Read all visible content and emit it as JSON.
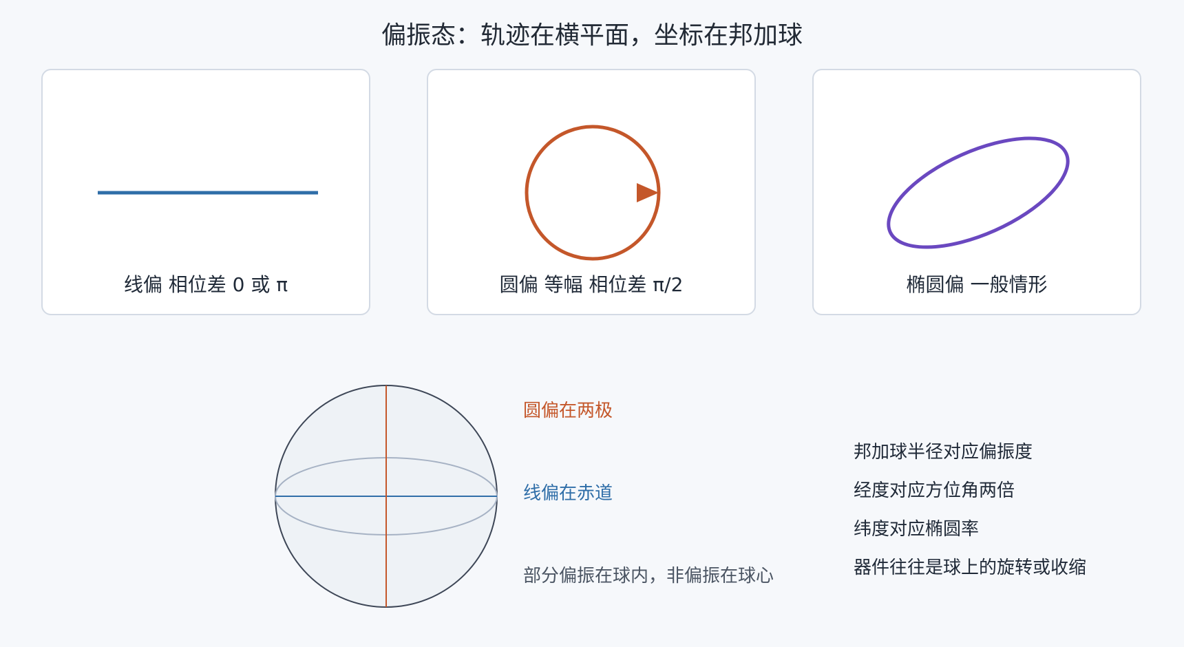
{
  "title": "偏振态：轨迹在横平面，坐标在邦加球",
  "cards": [
    {
      "label": "线偏 相位差 0 或 π",
      "color": "#2f6ea8",
      "shape": "line"
    },
    {
      "label": "圆偏 等幅 相位差 π/2",
      "color": "#c4572a",
      "shape": "circle-with-arrow"
    },
    {
      "label": "椭圆偏 一般情形",
      "color": "#6a48c0",
      "shape": "tilted-ellipse"
    }
  ],
  "sphere": {
    "labels": {
      "poles": "圆偏在两极",
      "equator": "线偏在赤道",
      "interior": "部分偏振在球内，非偏振在球心"
    },
    "colors": {
      "poles": "#c4572a",
      "equator": "#2f6ea8",
      "interior": "#4b5563"
    }
  },
  "facts": [
    "邦加球半径对应偏振度",
    "经度对应方位角两倍",
    "纬度对应椭圆率",
    "器件往往是球上的旋转或收缩"
  ]
}
